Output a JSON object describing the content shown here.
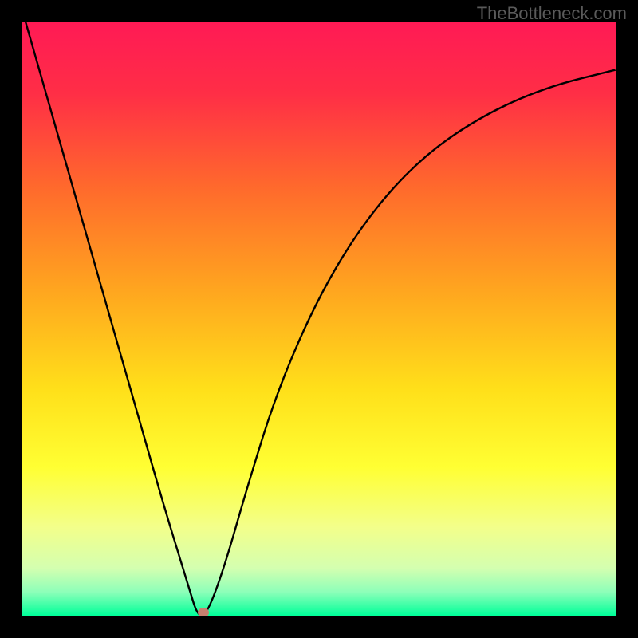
{
  "attribution": "TheBottleneck.com",
  "colors": {
    "frame": "#000000",
    "curve": "#000000",
    "marker": "#c77f6f",
    "gradient_stops": [
      {
        "offset": 0.0,
        "color": "#ff1a55"
      },
      {
        "offset": 0.12,
        "color": "#ff2e46"
      },
      {
        "offset": 0.28,
        "color": "#ff6a2c"
      },
      {
        "offset": 0.45,
        "color": "#ffa51f"
      },
      {
        "offset": 0.62,
        "color": "#ffe01a"
      },
      {
        "offset": 0.75,
        "color": "#ffff33"
      },
      {
        "offset": 0.85,
        "color": "#f3ff8a"
      },
      {
        "offset": 0.92,
        "color": "#d4ffb0"
      },
      {
        "offset": 0.96,
        "color": "#8dffb9"
      },
      {
        "offset": 1.0,
        "color": "#00ff99"
      }
    ]
  },
  "chart_data": {
    "type": "line",
    "title": "",
    "xlabel": "",
    "ylabel": "",
    "xlim": [
      0,
      1
    ],
    "ylim": [
      0,
      1
    ],
    "series": [
      {
        "name": "bottleneck-curve",
        "x": [
          0.0,
          0.04,
          0.08,
          0.12,
          0.16,
          0.2,
          0.24,
          0.28,
          0.295,
          0.31,
          0.34,
          0.38,
          0.43,
          0.5,
          0.58,
          0.67,
          0.77,
          0.88,
          1.0
        ],
        "values": [
          1.02,
          0.88,
          0.74,
          0.6,
          0.46,
          0.32,
          0.18,
          0.05,
          0.0,
          0.0,
          0.08,
          0.22,
          0.38,
          0.54,
          0.67,
          0.77,
          0.84,
          0.89,
          0.92
        ]
      }
    ],
    "marker": {
      "x": 0.305,
      "y": 0.005
    },
    "annotations": []
  }
}
